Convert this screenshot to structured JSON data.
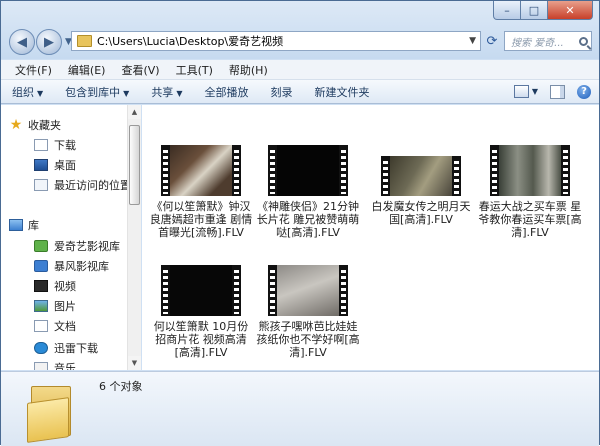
{
  "window": {
    "caption": {
      "minimize": "–",
      "maximize": "□",
      "close": "✕"
    }
  },
  "addressbar": {
    "path": "C:\\Users\\Lucia\\Desktop\\爱奇艺视频"
  },
  "search": {
    "placeholder": "搜索 爱奇..."
  },
  "menubar": {
    "items": [
      "文件(F)",
      "编辑(E)",
      "查看(V)",
      "工具(T)",
      "帮助(H)"
    ]
  },
  "toolbar": {
    "organize": "组织",
    "include": "包含到库中",
    "share": "共享",
    "playall": "全部播放",
    "burn": "刻录",
    "newfolder": "新建文件夹"
  },
  "navpane": {
    "favorites": "收藏夹",
    "fav_items": [
      "下载",
      "桌面",
      "最近访问的位置"
    ],
    "libraries": "库",
    "lib_items": [
      "爱奇艺影视库",
      "暴风影视库",
      "视频",
      "图片",
      "文档",
      "迅雷下载",
      "音乐"
    ]
  },
  "files": [
    {
      "name": "《何以笙箫默》钟汉良唐嫣超市重逢 剧情首曝光[流畅].FLV"
    },
    {
      "name": "《神雕侠侣》21分钟长片花 雕兄被赞萌萌哒[高清].FLV"
    },
    {
      "name": "白发魔女传之明月天国[高清].FLV"
    },
    {
      "name": "春运大战之买车票 星爷教你春运买车票[高清].FLV"
    },
    {
      "name": "何以笙箫默 10月份招商片花 视频高清[高清].FLV"
    },
    {
      "name": "熊孩子嘿咻芭比娃娃 孩纸你也不学好啊[高清].FLV"
    }
  ],
  "details": {
    "count": "6 个对象"
  }
}
